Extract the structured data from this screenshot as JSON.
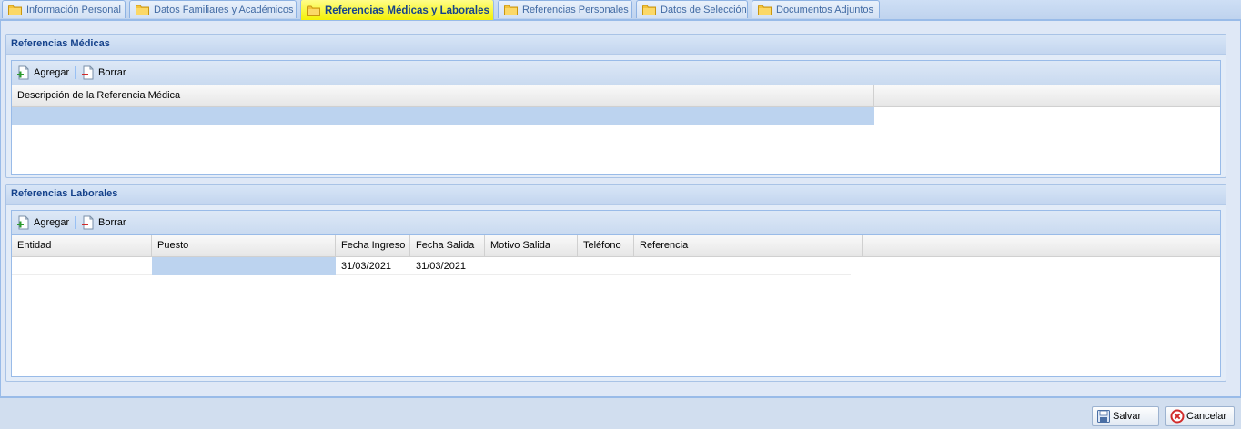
{
  "tabs": [
    {
      "label": "Información Personal",
      "active": false
    },
    {
      "label": "Datos Familiares y Académicos",
      "active": false
    },
    {
      "label": "Referencias Médicas y Laborales",
      "active": true
    },
    {
      "label": "Referencias Personales",
      "active": false
    },
    {
      "label": "Datos de Selección",
      "active": false
    },
    {
      "label": "Documentos Adjuntos",
      "active": false
    }
  ],
  "medical": {
    "title": "Referencias Médicas",
    "toolbar": {
      "add_label": "Agregar",
      "delete_label": "Borrar"
    },
    "columns": [
      "Descripción de la Referencia Médica"
    ],
    "rows": [
      {
        "descripcion": ""
      }
    ]
  },
  "work": {
    "title": "Referencias Laborales",
    "toolbar": {
      "add_label": "Agregar",
      "delete_label": "Borrar"
    },
    "columns": [
      "Entidad",
      "Puesto",
      "Fecha Ingreso",
      "Fecha Salida",
      "Motivo Salida",
      "Teléfono",
      "Referencia"
    ],
    "rows": [
      {
        "entidad": "",
        "puesto": "",
        "fecha_ingreso": "31/03/2021",
        "fecha_salida": "31/03/2021",
        "motivo_salida": "",
        "telefono": "",
        "referencia": ""
      }
    ]
  },
  "footer": {
    "save_label": "Salvar",
    "cancel_label": "Cancelar"
  },
  "colors": {
    "active_tab": "#f2f000",
    "selection": "#bcd3ef",
    "title_text": "#15428b"
  }
}
